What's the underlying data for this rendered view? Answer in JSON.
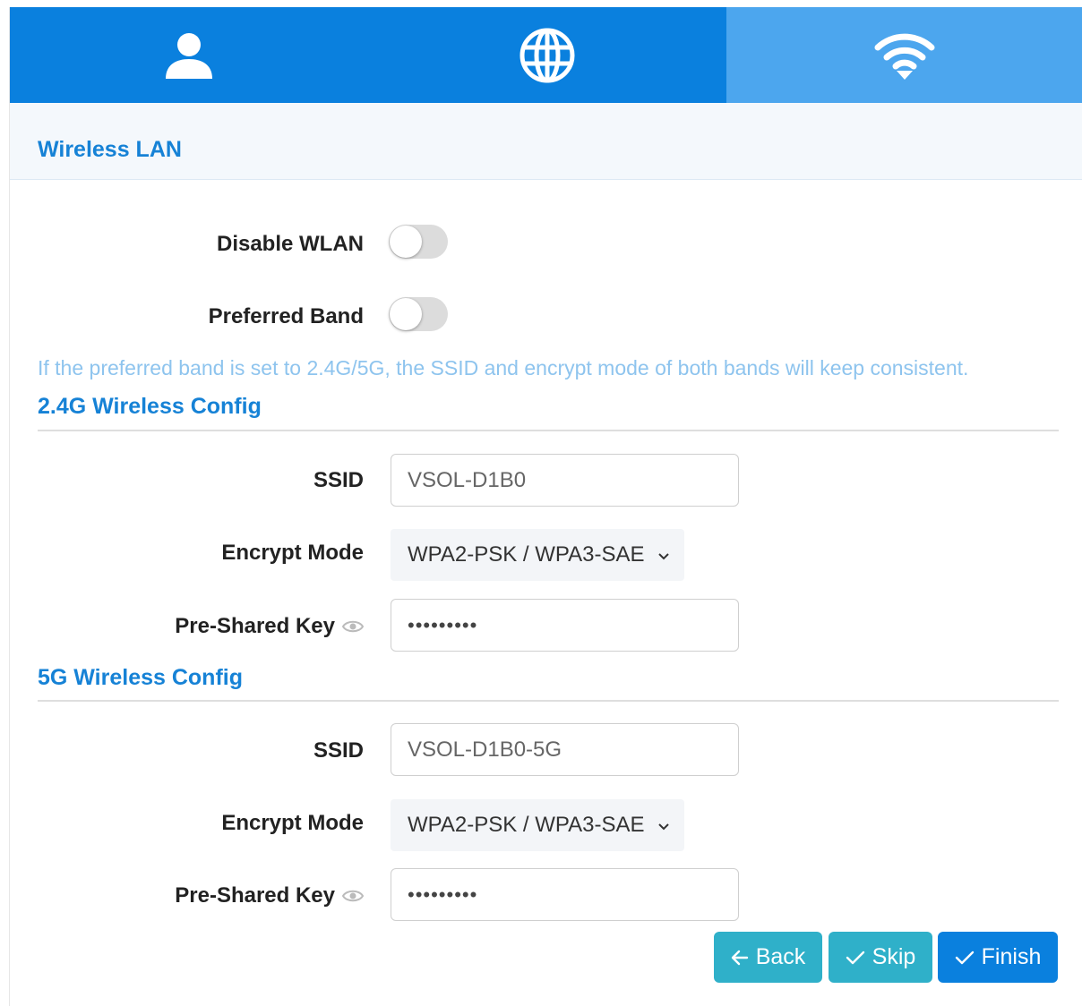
{
  "tabs": [
    {
      "icon": "user-icon",
      "active": false
    },
    {
      "icon": "globe-icon",
      "active": false
    },
    {
      "icon": "wifi-icon",
      "active": true
    }
  ],
  "section": {
    "title": "Wireless LAN"
  },
  "wlan": {
    "disable_label": "Disable WLAN",
    "disable_on": false,
    "preferred_label": "Preferred Band",
    "preferred_on": false,
    "hint": "If the preferred band is set to 2.4G/5G, the SSID and encrypt mode of both bands will keep consistent."
  },
  "band24": {
    "title": "2.4G Wireless Config",
    "ssid_label": "SSID",
    "ssid_value": "VSOL-D1B0",
    "encrypt_label": "Encrypt Mode",
    "encrypt_value": "WPA2-PSK / WPA3-SAE",
    "key_label": "Pre-Shared Key",
    "key_value": "•••••••••"
  },
  "band5": {
    "title": "5G Wireless Config",
    "ssid_label": "SSID",
    "ssid_value": "VSOL-D1B0-5G",
    "encrypt_label": "Encrypt Mode",
    "encrypt_value": "WPA2-PSK / WPA3-SAE",
    "key_label": "Pre-Shared Key",
    "key_value": "•••••••••"
  },
  "buttons": {
    "back": "Back",
    "skip": "Skip",
    "finish": "Finish"
  },
  "colors": {
    "primary": "#0a80de",
    "tab_active": "#4ca6ee",
    "secondary_button": "#2fb0c9",
    "hint_text": "#8ec4ee"
  }
}
